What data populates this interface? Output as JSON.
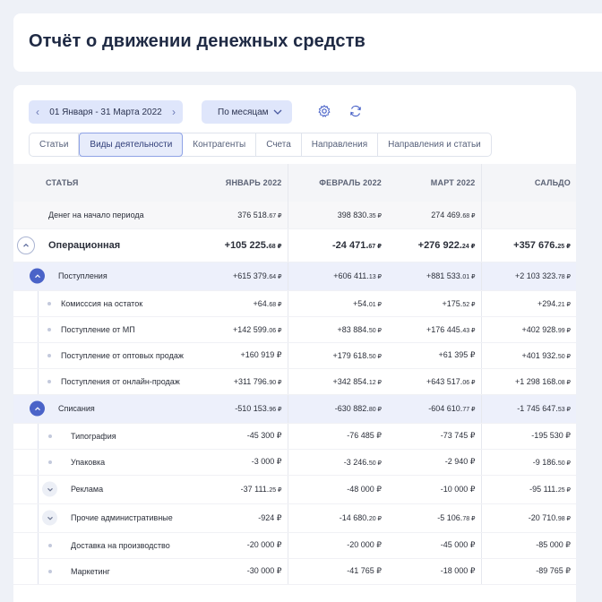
{
  "page": {
    "title": "Отчёт о движении денежных средств"
  },
  "toolbar": {
    "date_range": "01 Января - 31 Марта 2022",
    "period": "По месяцам",
    "icons": [
      "gear-icon",
      "refresh-icon"
    ]
  },
  "tabs": [
    {
      "label": "Статьи",
      "active": false
    },
    {
      "label": "Виды деятельности",
      "active": true
    },
    {
      "label": "Контрагенты",
      "active": false
    },
    {
      "label": "Счета",
      "active": false
    },
    {
      "label": "Направления",
      "active": false
    },
    {
      "label": "Направления и статьи",
      "active": false
    }
  ],
  "table": {
    "headers": [
      "СТАТЬЯ",
      "ЯНВАРЬ 2022",
      "ФЕВРАЛЬ 2022",
      "МАРТ 2022",
      "САЛЬДО"
    ],
    "rows": [
      {
        "kind": "start",
        "level": 0,
        "name": "Денег на начало периода",
        "values": [
          [
            "376 518.",
            "67 ₽"
          ],
          [
            "398 830.",
            "35 ₽"
          ],
          [
            "274 469.",
            "68 ₽"
          ],
          [
            "",
            ""
          ]
        ]
      },
      {
        "kind": "op",
        "level": 0,
        "name": "Операционная",
        "values": [
          [
            "+105 225.",
            "68 ₽"
          ],
          [
            "-24 471.",
            "67 ₽"
          ],
          [
            "+276 922.",
            "24 ₽"
          ],
          [
            "+357 676.",
            "25 ₽"
          ]
        ]
      },
      {
        "kind": "group",
        "level": 1,
        "name": "Поступления",
        "values": [
          [
            "+615 379.",
            "64 ₽"
          ],
          [
            "+606 411.",
            "13 ₽"
          ],
          [
            "+881 533.",
            "01 ₽"
          ],
          [
            "+2 103 323.",
            "78 ₽"
          ]
        ]
      },
      {
        "kind": "item",
        "level": 2,
        "name": "Комисссия на остаток",
        "values": [
          [
            "+64.",
            "68 ₽"
          ],
          [
            "+54.",
            "01 ₽"
          ],
          [
            "+175.",
            "52 ₽"
          ],
          [
            "+294.",
            "21 ₽"
          ]
        ]
      },
      {
        "kind": "item",
        "level": 2,
        "name": "Поступление от МП",
        "values": [
          [
            "+142 599.",
            "06 ₽"
          ],
          [
            "+83 884.",
            "50 ₽"
          ],
          [
            "+176 445.",
            "43 ₽"
          ],
          [
            "+402 928.",
            "99 ₽"
          ]
        ]
      },
      {
        "kind": "item",
        "level": 2,
        "name": "Поступление от оптовых продаж",
        "values": [
          [
            "+160 919 ₽",
            ""
          ],
          [
            "+179 618.",
            "50 ₽"
          ],
          [
            "+61 395 ₽",
            ""
          ],
          [
            "+401 932.",
            "50 ₽"
          ]
        ]
      },
      {
        "kind": "item",
        "level": 2,
        "name": "Поступления от онлайн-продаж",
        "values": [
          [
            "+311 796.",
            "90 ₽"
          ],
          [
            "+342 854.",
            "12 ₽"
          ],
          [
            "+643 517.",
            "06 ₽"
          ],
          [
            "+1 298 168.",
            "08 ₽"
          ]
        ]
      },
      {
        "kind": "group",
        "level": 1,
        "name": "Списания",
        "values": [
          [
            "-510 153.",
            "96 ₽"
          ],
          [
            "-630 882.",
            "80 ₽"
          ],
          [
            "-604 610.",
            "77 ₽"
          ],
          [
            "-1 745 647.",
            "53 ₽"
          ]
        ]
      },
      {
        "kind": "item",
        "level": 3,
        "name": "Типография",
        "values": [
          [
            "-45 300 ₽",
            ""
          ],
          [
            "-76 485 ₽",
            ""
          ],
          [
            "-73 745 ₽",
            ""
          ],
          [
            "-195 530 ₽",
            ""
          ]
        ]
      },
      {
        "kind": "item",
        "level": 3,
        "name": "Упаковка",
        "values": [
          [
            "-3 000 ₽",
            ""
          ],
          [
            "-3 246.",
            "50 ₽"
          ],
          [
            "-2 940 ₽",
            ""
          ],
          [
            "-9 186.",
            "50 ₽"
          ]
        ]
      },
      {
        "kind": "item",
        "level": 3,
        "expandable": true,
        "name": "Реклама",
        "values": [
          [
            "-37 111.",
            "25 ₽"
          ],
          [
            "-48 000 ₽",
            ""
          ],
          [
            "-10 000 ₽",
            ""
          ],
          [
            "-95 111.",
            "25 ₽"
          ]
        ]
      },
      {
        "kind": "item",
        "level": 3,
        "expandable": true,
        "name": "Прочие административные",
        "values": [
          [
            "-924 ₽",
            ""
          ],
          [
            "-14 680.",
            "20 ₽"
          ],
          [
            "-5 106.",
            "78 ₽"
          ],
          [
            "-20 710.",
            "98 ₽"
          ]
        ]
      },
      {
        "kind": "item",
        "level": 3,
        "name": "Доставка на производство",
        "values": [
          [
            "-20 000 ₽",
            ""
          ],
          [
            "-20 000 ₽",
            ""
          ],
          [
            "-45 000 ₽",
            ""
          ],
          [
            "-85 000 ₽",
            ""
          ]
        ]
      },
      {
        "kind": "item",
        "level": 3,
        "name": "Маркетинг",
        "values": [
          [
            "-30 000 ₽",
            ""
          ],
          [
            "-41 765 ₽",
            ""
          ],
          [
            "-18 000 ₽",
            ""
          ],
          [
            "-89 765 ₽",
            ""
          ]
        ]
      }
    ]
  },
  "colors": {
    "positive": "#27a141",
    "negative": "#3a55b0",
    "accent": "#4a63c8"
  }
}
